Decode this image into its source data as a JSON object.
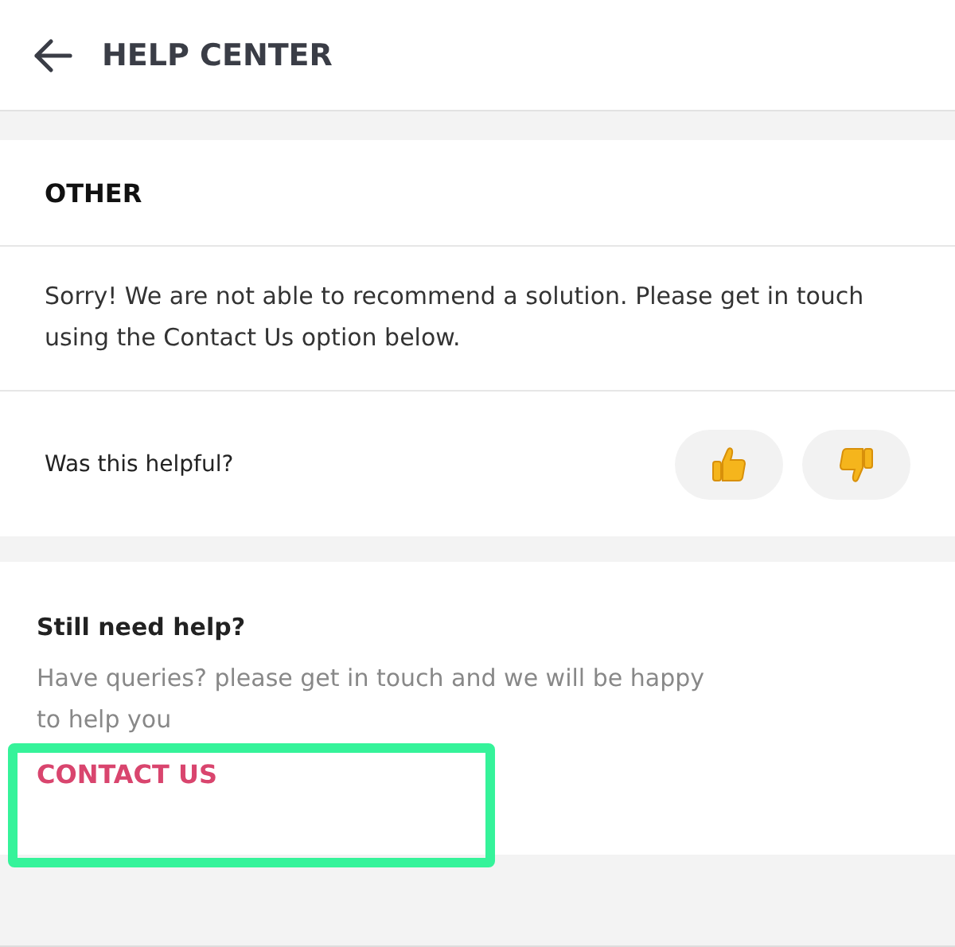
{
  "header": {
    "title": "HELP CENTER"
  },
  "article": {
    "title": "OTHER",
    "body": "Sorry! We are not able to recommend a solution. Please get in touch using the Contact Us option below.",
    "feedback_question": "Was this helpful?"
  },
  "help": {
    "title": "Still need help?",
    "text": "Have queries? please get in touch and we will be happy to help you",
    "link": "CONTACT US",
    "highlighted": true
  }
}
